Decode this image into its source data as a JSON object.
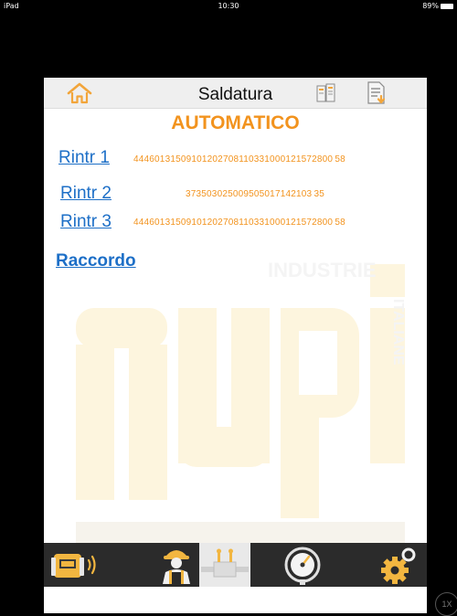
{
  "status_bar": {
    "device": "iPad",
    "time": "10:30",
    "battery": "89%"
  },
  "header": {
    "title": "Saldatura",
    "home_icon": "home-icon",
    "book_icon": "book-icon",
    "export_icon": "export-document-icon"
  },
  "main": {
    "mode": "AUTOMATICO",
    "rows": [
      {
        "label": "Rintr 1",
        "code": "44460131509101202708110331000121572800 58"
      },
      {
        "label": "Rintr 2",
        "code": "373503025009505017142103 35"
      },
      {
        "label": "Rintr 3",
        "code": "44460131509101202708110331000121572800 58"
      }
    ],
    "raccordo": "Raccordo",
    "watermark": {
      "brand": "nupi",
      "side_text_top": "INDUSTRIE",
      "side_text_right": "ITALIANE"
    }
  },
  "tabs": [
    {
      "name": "machine-connection",
      "icon": "welding-machine-signal-icon",
      "active": false
    },
    {
      "name": "operator",
      "icon": "worker-icon",
      "active": false
    },
    {
      "name": "welding",
      "icon": "fitting-welding-icon",
      "active": true
    },
    {
      "name": "pressure",
      "icon": "pressure-gauge-icon",
      "active": false
    },
    {
      "name": "settings",
      "icon": "settings-gear-icon",
      "active": false
    }
  ],
  "zoom_badge": "1X",
  "colors": {
    "accent_orange": "#f2931e",
    "link_blue": "#1d6fc7",
    "tabbar_bg": "#2b2b2b",
    "header_bg": "#efefef"
  }
}
